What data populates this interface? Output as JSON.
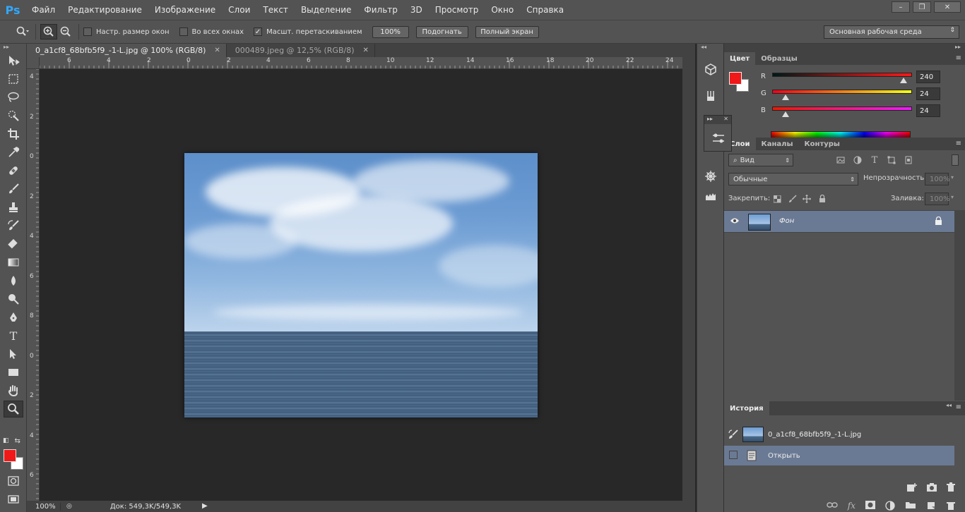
{
  "app": {
    "logo": "Ps"
  },
  "menu": [
    "Файл",
    "Редактирование",
    "Изображение",
    "Слои",
    "Текст",
    "Выделение",
    "Фильтр",
    "3D",
    "Просмотр",
    "Окно",
    "Справка"
  ],
  "window_controls": {
    "minimize": "–",
    "restore": "❐",
    "close": "✕"
  },
  "options": {
    "resize_windows": "Настр. размер окон",
    "all_windows": "Во всех окнах",
    "scrubby_zoom": "Масшт. перетаскиванием",
    "scrubby_checked": "✓",
    "btn_100": "100%",
    "btn_fit": "Подогнать",
    "btn_fullscreen": "Полный экран",
    "workspace": "Основная рабочая среда"
  },
  "doc_tabs": [
    {
      "title": "0_a1cf8_68bfb5f9_-1-L.jpg @ 100% (RGB/8)",
      "active": true
    },
    {
      "title": "000489.jpeg @ 12,5% (RGB/8)",
      "active": false
    }
  ],
  "tab_close": "✕",
  "ruler_top": [
    "6",
    "4",
    "2",
    "0",
    "2",
    "4",
    "6",
    "8",
    "10",
    "12",
    "14",
    "16",
    "18",
    "20",
    "22",
    "24"
  ],
  "ruler_left": [
    "4",
    "2",
    "0",
    "2",
    "4",
    "6",
    "8",
    "0",
    "2",
    "4",
    "6"
  ],
  "status": {
    "zoom": "100%",
    "doc": "Док: 549,3K/549,3K"
  },
  "color_panel": {
    "tabs": [
      "Цвет",
      "Образцы"
    ],
    "channels": [
      {
        "label": "R",
        "value": "240",
        "fraction": 0.941,
        "gradient": "linear-gradient(90deg, #001818, #ff1818)"
      },
      {
        "label": "G",
        "value": "24",
        "fraction": 0.094,
        "gradient": "linear-gradient(90deg, #f00018, #f0ff18)"
      },
      {
        "label": "B",
        "value": "24",
        "fraction": 0.094,
        "gradient": "linear-gradient(90deg, #f01800, #f018ff)"
      }
    ],
    "fg": "#f01818"
  },
  "layers_panel": {
    "tabs": [
      "Слои",
      "Каналы",
      "Контуры"
    ],
    "filter": "Вид",
    "blend_mode": "Обычные",
    "opacity_label": "Непрозрачность:",
    "opacity_value": "100%",
    "lock_label": "Закрепить:",
    "fill_label": "Заливка:",
    "fill_value": "100%",
    "layer_name": "Фон"
  },
  "history_panel": {
    "tab": "История",
    "snapshot": "0_a1cf8_68bfb5f9_-1-L.jpg",
    "step": "Открыть"
  }
}
